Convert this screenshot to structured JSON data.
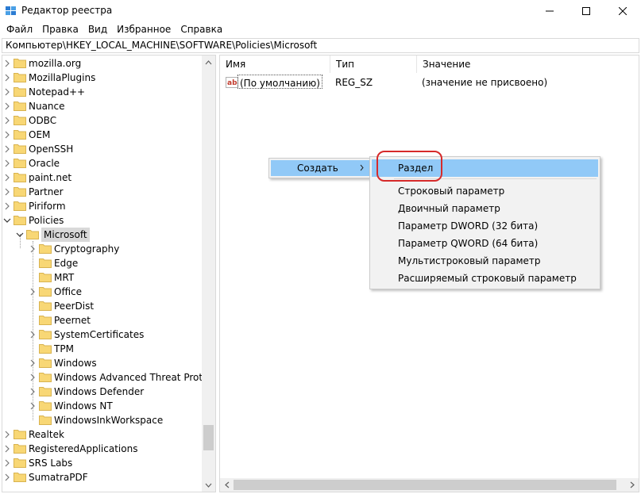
{
  "window": {
    "title": "Редактор реестра"
  },
  "menu": [
    "Файл",
    "Правка",
    "Вид",
    "Избранное",
    "Справка"
  ],
  "address": "Компьютер\\HKEY_LOCAL_MACHINE\\SOFTWARE\\Policies\\Microsoft",
  "tree": {
    "items": [
      {
        "label": "mozilla.org",
        "expanded": false
      },
      {
        "label": "MozillaPlugins",
        "expanded": false
      },
      {
        "label": "Notepad++",
        "expanded": false
      },
      {
        "label": "Nuance",
        "expanded": false
      },
      {
        "label": "ODBC",
        "expanded": false
      },
      {
        "label": "OEM",
        "expanded": false
      },
      {
        "label": "OpenSSH",
        "expanded": false
      },
      {
        "label": "Oracle",
        "expanded": false
      },
      {
        "label": "paint.net",
        "expanded": false
      },
      {
        "label": "Partner",
        "expanded": false
      },
      {
        "label": "Piriform",
        "expanded": false
      },
      {
        "label": "Policies",
        "expanded": true
      },
      {
        "label": "Microsoft",
        "expanded": true,
        "selected": true
      },
      {
        "label": "Cryptography",
        "expanded": false
      },
      {
        "label": "Edge",
        "expanded": false
      },
      {
        "label": "MRT",
        "expanded": false
      },
      {
        "label": "Office",
        "expanded": false
      },
      {
        "label": "PeerDist",
        "expanded": false
      },
      {
        "label": "Peernet",
        "expanded": false
      },
      {
        "label": "SystemCertificates",
        "expanded": false
      },
      {
        "label": "TPM",
        "expanded": false
      },
      {
        "label": "Windows",
        "expanded": false
      },
      {
        "label": "Windows Advanced Threat Protecti",
        "expanded": false
      },
      {
        "label": "Windows Defender",
        "expanded": false
      },
      {
        "label": "Windows NT",
        "expanded": false
      },
      {
        "label": "WindowsInkWorkspace",
        "expanded": false
      },
      {
        "label": "Realtek",
        "expanded": false
      },
      {
        "label": "RegisteredApplications",
        "expanded": false
      },
      {
        "label": "SRS Labs",
        "expanded": false
      },
      {
        "label": "SumatraPDF",
        "expanded": false
      }
    ]
  },
  "list": {
    "columns": [
      "Имя",
      "Тип",
      "Значение"
    ],
    "rows": [
      {
        "name": "(По умолчанию)",
        "type": "REG_SZ",
        "value": "(значение не присвоено)"
      }
    ]
  },
  "context_menu": {
    "create_label": "Создать",
    "submenu": [
      "Раздел",
      "Строковый параметр",
      "Двоичный параметр",
      "Параметр DWORD (32 бита)",
      "Параметр QWORD (64 бита)",
      "Мультистроковый параметр",
      "Расширяемый строковый параметр"
    ]
  },
  "colors": {
    "menu_highlight": "#91c9f7",
    "folder": "#f8d775",
    "annotation": "#d62a2a"
  }
}
